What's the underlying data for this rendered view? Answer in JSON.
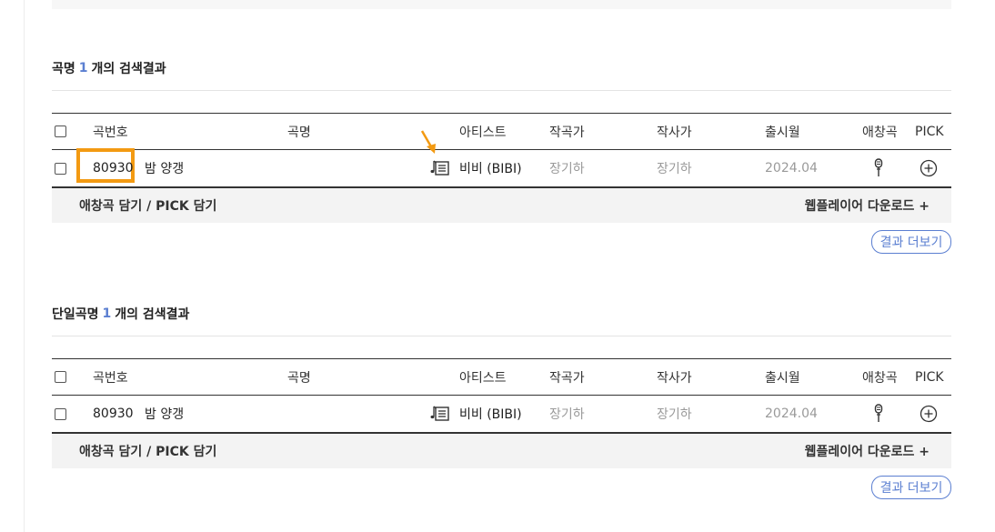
{
  "sections": [
    {
      "title_prefix": "곡명",
      "count": "1",
      "title_suffix": "개의 검색결과",
      "headers": {
        "number": "곡번호",
        "title": "곡명",
        "artist": "아티스트",
        "composer": "작곡가",
        "lyricist": "작사가",
        "release": "출시월",
        "favorite": "애창곡",
        "pick": "PICK"
      },
      "row": {
        "number": "80930",
        "title": "밤 양갱",
        "artist": "비비 (BIBI)",
        "composer": "장기하",
        "lyricist": "장기하",
        "release": "2024.04"
      },
      "actions": {
        "left": "애창곡 담기 / PICK 담기",
        "right": "웹플레이어 다운로드 +"
      },
      "more": "결과 더보기"
    },
    {
      "title_prefix": "단일곡명",
      "count": "1",
      "title_suffix": "개의 검색결과",
      "headers": {
        "number": "곡번호",
        "title": "곡명",
        "artist": "아티스트",
        "composer": "작곡가",
        "lyricist": "작사가",
        "release": "출시월",
        "favorite": "애창곡",
        "pick": "PICK"
      },
      "row": {
        "number": "80930",
        "title": "밤 양갱",
        "artist": "비비 (BIBI)",
        "composer": "장기하",
        "lyricist": "장기하",
        "release": "2024.04"
      },
      "actions": {
        "left": "애창곡 담기 / PICK 담기",
        "right": "웹플레이어 다운로드 +"
      },
      "more": "결과 더보기"
    }
  ],
  "colors": {
    "accent": "#5b7fd1",
    "highlight": "#f39a12",
    "bar": "#f3f3f3"
  },
  "icons": {
    "lyrics": "lyrics-sheet-icon",
    "favorite": "microphone-icon",
    "pick": "plus-circle-icon",
    "annotation": "arrow-annotation"
  }
}
